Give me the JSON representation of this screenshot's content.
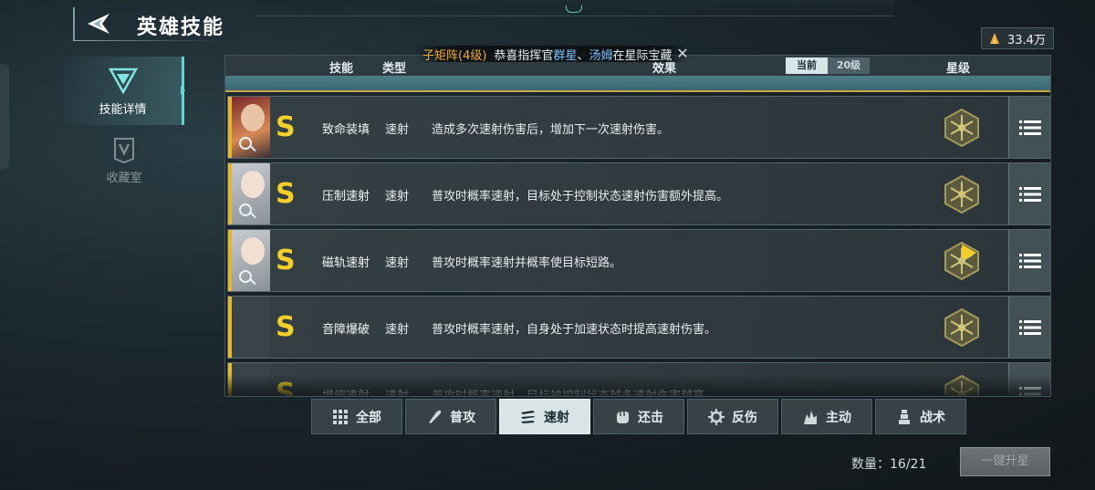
{
  "page": {
    "title": "英雄技能"
  },
  "currency": {
    "amount": "33.4万",
    "icon": "fuel-icon",
    "color": "#f2a93b"
  },
  "sidebar": {
    "items": [
      {
        "label": "技能详情",
        "icon": "v-emblem-icon",
        "active": true
      },
      {
        "label": "收藏室",
        "icon": "vault-icon",
        "active": false
      }
    ]
  },
  "ticker": {
    "prefix": "子矩阵(4级)",
    "text1": "恭喜指挥官",
    "name1": "群星",
    "sep": "、",
    "name2": "汤姆",
    "text2": "在星际宝藏",
    "close": "✕"
  },
  "table": {
    "headers": {
      "skill": "技能",
      "type": "类型",
      "effect": "效果",
      "star": "星级"
    },
    "level_toggle": {
      "current": "当前",
      "level20": "20级"
    },
    "rows": [
      {
        "grade": "S",
        "name": "致命装填",
        "type": "速射",
        "effect": "造成多次速射伤害后，增加下一次速射伤害。"
      },
      {
        "grade": "S",
        "name": "压制速射",
        "type": "速射",
        "effect": "普攻时概率速射，目标处于控制状态速射伤害额外提高。"
      },
      {
        "grade": "S",
        "name": "磁轨速射",
        "type": "速射",
        "effect": "普攻时概率速射并概率使目标短路。"
      },
      {
        "grade": "S",
        "name": "音障爆破",
        "type": "速射",
        "effect": "普攻时概率速射，自身处于加速状态时提高速射伤害。"
      },
      {
        "grade": "S",
        "name": "增缩速射",
        "type": "速射",
        "effect": "普攻时概率速射，目标被控制状态越多速射伤害越高。"
      }
    ]
  },
  "filter_tabs": [
    {
      "label": "全部",
      "icon": "grid-icon",
      "active": false
    },
    {
      "label": "普攻",
      "icon": "bullet-icon",
      "active": false
    },
    {
      "label": "速射",
      "icon": "rapid-fire-icon",
      "active": true
    },
    {
      "label": "还击",
      "icon": "fist-icon",
      "active": false
    },
    {
      "label": "反伤",
      "icon": "gear-icon",
      "active": false
    },
    {
      "label": "主动",
      "icon": "flame-icon",
      "active": false
    },
    {
      "label": "战术",
      "icon": "tower-icon",
      "active": false
    }
  ],
  "footer": {
    "count_label": "数量：",
    "count_value": "16/21",
    "upgrade_label": "一键升星"
  },
  "colors": {
    "accent": "#5fd6d2",
    "grade": "#f4cf2a",
    "border_gold": "#e5b72b"
  }
}
